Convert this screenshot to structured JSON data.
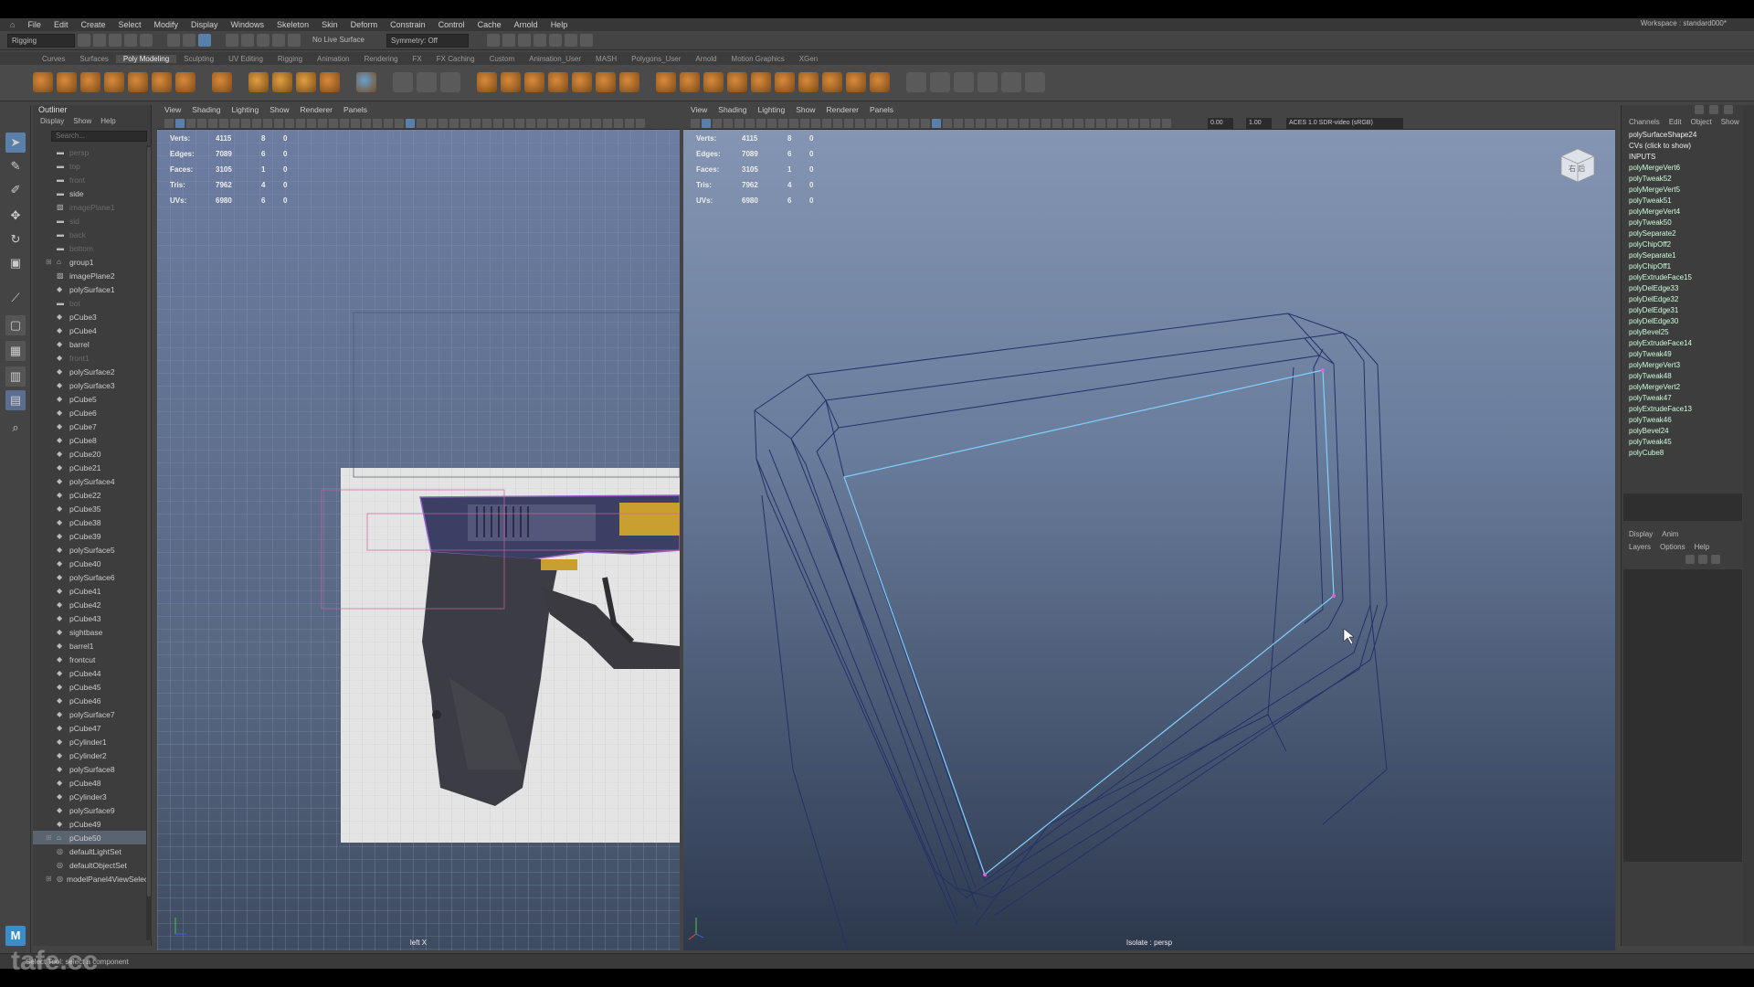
{
  "menu": [
    "File",
    "Edit",
    "Create",
    "Select",
    "Modify",
    "Display",
    "Windows",
    "Skeleton",
    "Skin",
    "Deform",
    "Constrain",
    "Control",
    "Cache",
    "Arnold",
    "Help"
  ],
  "workspace": "Workspace : standard000*",
  "statusline": {
    "mode": "Rigging",
    "live_surface": "No Live Surface",
    "symmetry": "Symmetry: Off"
  },
  "shelf_tabs": [
    "Curves",
    "Surfaces",
    "Poly Modeling",
    "Sculpting",
    "UV Editing",
    "Rigging",
    "Animation",
    "Rendering",
    "FX",
    "FX Caching",
    "Custom",
    "Animation_User",
    "MASH",
    "Polygons_User",
    "Arnold",
    "Motion Graphics",
    "XGen"
  ],
  "active_shelf": "Poly Modeling",
  "outliner": {
    "title": "Outliner",
    "menu": [
      "Display",
      "Show",
      "Help"
    ],
    "search_placeholder": "Search...",
    "items": [
      {
        "name": "persp",
        "dim": true,
        "icon": "camera"
      },
      {
        "name": "top",
        "dim": true,
        "icon": "camera"
      },
      {
        "name": "front",
        "dim": true,
        "icon": "camera"
      },
      {
        "name": "side",
        "dim": false,
        "icon": "camera"
      },
      {
        "name": "imagePlane1",
        "dim": true,
        "icon": "image"
      },
      {
        "name": "sid",
        "dim": true,
        "icon": "camera"
      },
      {
        "name": "back",
        "dim": true,
        "icon": "camera"
      },
      {
        "name": "bottom",
        "dim": true,
        "icon": "camera"
      },
      {
        "name": "group1",
        "dim": false,
        "icon": "group",
        "expand": true
      },
      {
        "name": "imagePlane2",
        "dim": false,
        "icon": "image"
      },
      {
        "name": "polySurface1",
        "dim": false,
        "icon": "mesh"
      },
      {
        "name": "bot",
        "dim": true,
        "icon": "camera"
      },
      {
        "name": "pCube3",
        "dim": false,
        "icon": "mesh"
      },
      {
        "name": "pCube4",
        "dim": false,
        "icon": "mesh"
      },
      {
        "name": "barrel",
        "dim": false,
        "icon": "mesh"
      },
      {
        "name": "front1",
        "dim": true,
        "icon": "mesh"
      },
      {
        "name": "polySurface2",
        "dim": false,
        "icon": "mesh"
      },
      {
        "name": "polySurface3",
        "dim": false,
        "icon": "mesh"
      },
      {
        "name": "pCube5",
        "dim": false,
        "icon": "mesh"
      },
      {
        "name": "pCube6",
        "dim": false,
        "icon": "mesh"
      },
      {
        "name": "pCube7",
        "dim": false,
        "icon": "mesh"
      },
      {
        "name": "pCube8",
        "dim": false,
        "icon": "mesh"
      },
      {
        "name": "pCube20",
        "dim": false,
        "icon": "mesh"
      },
      {
        "name": "pCube21",
        "dim": false,
        "icon": "mesh"
      },
      {
        "name": "polySurface4",
        "dim": false,
        "icon": "mesh"
      },
      {
        "name": "pCube22",
        "dim": false,
        "icon": "mesh"
      },
      {
        "name": "pCube35",
        "dim": false,
        "icon": "mesh"
      },
      {
        "name": "pCube38",
        "dim": false,
        "icon": "mesh"
      },
      {
        "name": "pCube39",
        "dim": false,
        "icon": "mesh"
      },
      {
        "name": "polySurface5",
        "dim": false,
        "icon": "mesh"
      },
      {
        "name": "pCube40",
        "dim": false,
        "icon": "mesh"
      },
      {
        "name": "polySurface6",
        "dim": false,
        "icon": "mesh"
      },
      {
        "name": "pCube41",
        "dim": false,
        "icon": "mesh"
      },
      {
        "name": "pCube42",
        "dim": false,
        "icon": "mesh"
      },
      {
        "name": "pCube43",
        "dim": false,
        "icon": "mesh"
      },
      {
        "name": "sightbase",
        "dim": false,
        "icon": "mesh"
      },
      {
        "name": "barrel1",
        "dim": false,
        "icon": "mesh"
      },
      {
        "name": "frontcut",
        "dim": false,
        "icon": "mesh"
      },
      {
        "name": "pCube44",
        "dim": false,
        "icon": "mesh"
      },
      {
        "name": "pCube45",
        "dim": false,
        "icon": "mesh"
      },
      {
        "name": "pCube46",
        "dim": false,
        "icon": "mesh"
      },
      {
        "name": "polySurface7",
        "dim": false,
        "icon": "mesh"
      },
      {
        "name": "pCube47",
        "dim": false,
        "icon": "mesh"
      },
      {
        "name": "pCylinder1",
        "dim": false,
        "icon": "mesh"
      },
      {
        "name": "pCylinder2",
        "dim": false,
        "icon": "mesh"
      },
      {
        "name": "polySurface8",
        "dim": false,
        "icon": "mesh"
      },
      {
        "name": "pCube48",
        "dim": false,
        "icon": "mesh"
      },
      {
        "name": "pCylinder3",
        "dim": false,
        "icon": "mesh"
      },
      {
        "name": "polySurface9",
        "dim": false,
        "icon": "mesh"
      },
      {
        "name": "pCube49",
        "dim": false,
        "icon": "mesh"
      },
      {
        "name": "pCube50",
        "dim": false,
        "icon": "group",
        "expand": true,
        "sel": true
      },
      {
        "name": "defaultLightSet",
        "dim": false,
        "icon": "set"
      },
      {
        "name": "defaultObjectSet",
        "dim": false,
        "icon": "set"
      },
      {
        "name": "modelPanel4ViewSelec",
        "dim": false,
        "icon": "set",
        "expand": true
      }
    ]
  },
  "viewport_menu": [
    "View",
    "Shading",
    "Lighting",
    "Show",
    "Renderer",
    "Panels"
  ],
  "hud": {
    "rows": [
      {
        "label": "Verts:",
        "a": "4115",
        "b": "8",
        "c": "0"
      },
      {
        "label": "Edges:",
        "a": "7089",
        "b": "6",
        "c": "0"
      },
      {
        "label": "Faces:",
        "a": "3105",
        "b": "1",
        "c": "0"
      },
      {
        "label": "Tris:",
        "a": "7962",
        "b": "4",
        "c": "0"
      },
      {
        "label": "UVs:",
        "a": "6980",
        "b": "6",
        "c": "0"
      }
    ]
  },
  "left_viewport": {
    "label": "left X"
  },
  "right_viewport": {
    "label": "Isolate : persp",
    "exposure": "0.00",
    "gamma": "1.00",
    "colorspace": "ACES 1.0 SDR-video (sRGB)"
  },
  "channelbox": {
    "tabs": [
      "Channels",
      "Edit",
      "Object",
      "Show"
    ],
    "shape": "polySurfaceShape24",
    "cvs": "CVs (click to show)",
    "inputs_header": "INPUTS",
    "inputs": [
      "polyMergeVert6",
      "polyTweak52",
      "polyMergeVert5",
      "polyTweak51",
      "polyMergeVert4",
      "polyTweak50",
      "polySeparate2",
      "polyChipOff2",
      "polySeparate1",
      "polyChipOff1",
      "polyExtrudeFace15",
      "polyDelEdge33",
      "polyDelEdge32",
      "polyDelEdge31",
      "polyDelEdge30",
      "polyBevel25",
      "polyExtrudeFace14",
      "polyTweak49",
      "polyMergeVert3",
      "polyTweak48",
      "polyMergeVert2",
      "polyTweak47",
      "polyExtrudeFace13",
      "polyTweak46",
      "polyBevel24",
      "polyTweak45",
      "polyCube8"
    ],
    "layer_tabs": [
      "Display",
      "Anim"
    ],
    "layer_menu": [
      "Layers",
      "Options",
      "Help"
    ]
  },
  "status_text": "Select Tool: select a component",
  "watermark": "tafe.cc",
  "view_cube_label": "右 后"
}
